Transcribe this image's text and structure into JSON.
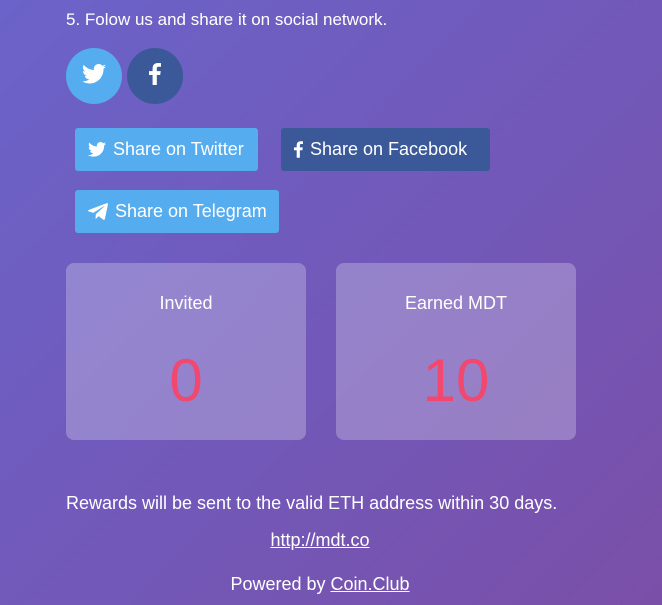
{
  "step": {
    "text": "5. Folow us and share it on social network."
  },
  "social_icons": {
    "twitter_icon": "twitter-bird-icon",
    "facebook_icon": "facebook-f-icon"
  },
  "share_buttons": {
    "twitter_label": "Share on Twitter",
    "facebook_label": "Share on Facebook",
    "telegram_label": "Share on Telegram"
  },
  "stats": {
    "invited_label": "Invited",
    "invited_value": "0",
    "earned_label": "Earned MDT",
    "earned_value": "10"
  },
  "footer": {
    "rewards_text": "Rewards will be sent to the valid ETH address within 30 days.",
    "site_link": "http://mdt.co",
    "powered_prefix": "Powered by ",
    "powered_link": "Coin.Club"
  },
  "colors": {
    "twitter_blue": "#55acee",
    "facebook_blue": "#3b5998",
    "stat_value_pink": "#f2476f",
    "background_start": "#6b63c9",
    "background_end": "#7a4fa8"
  }
}
